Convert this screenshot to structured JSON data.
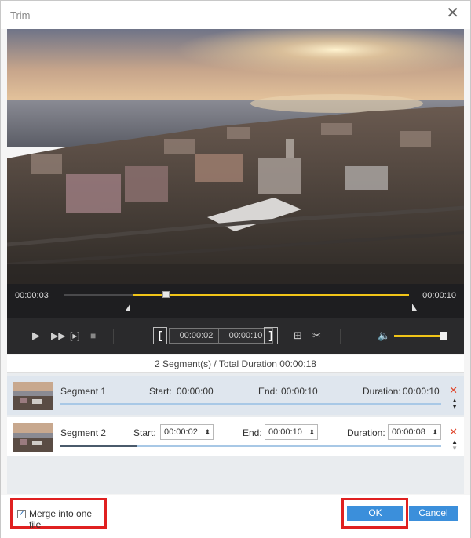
{
  "window": {
    "title": "Trim"
  },
  "timeline": {
    "start_time": "00:00:03",
    "end_time": "00:00:10",
    "selection_start_fraction": 0.2,
    "selection_end_fraction": 1.0,
    "playhead_fraction": 0.3
  },
  "controls": {
    "clip_start": "00:00:02",
    "clip_end": "00:00:10",
    "volume_fraction": 0.9,
    "icons": [
      "play-icon",
      "fast-forward-icon",
      "frame-step-icon",
      "stop-icon",
      "set-start-bracket-icon",
      "set-end-bracket-icon",
      "add-segment-icon",
      "split-icon",
      "volume-icon"
    ]
  },
  "segments_summary": "2 Segment(s) / Total Duration 00:00:18",
  "segments": [
    {
      "name": "Segment 1",
      "start_label": "Start:",
      "start": "00:00:00",
      "end_label": "End:",
      "end": "00:00:10",
      "duration_label": "Duration:",
      "duration": "00:00:10"
    },
    {
      "name": "Segment 2",
      "start_label": "Start:",
      "start": "00:00:02",
      "end_label": "End:",
      "end": "00:00:10",
      "duration_label": "Duration:",
      "duration": "00:00:08",
      "progress_fraction": 0.2
    }
  ],
  "footer": {
    "merge_label": "Merge into one file",
    "merge_checked": true,
    "ok_label": "OK",
    "cancel_label": "Cancel"
  },
  "colors": {
    "accent": "#f0c418",
    "button": "#3b8fdb",
    "highlight": "#e02020",
    "delete": "#e0452b"
  }
}
